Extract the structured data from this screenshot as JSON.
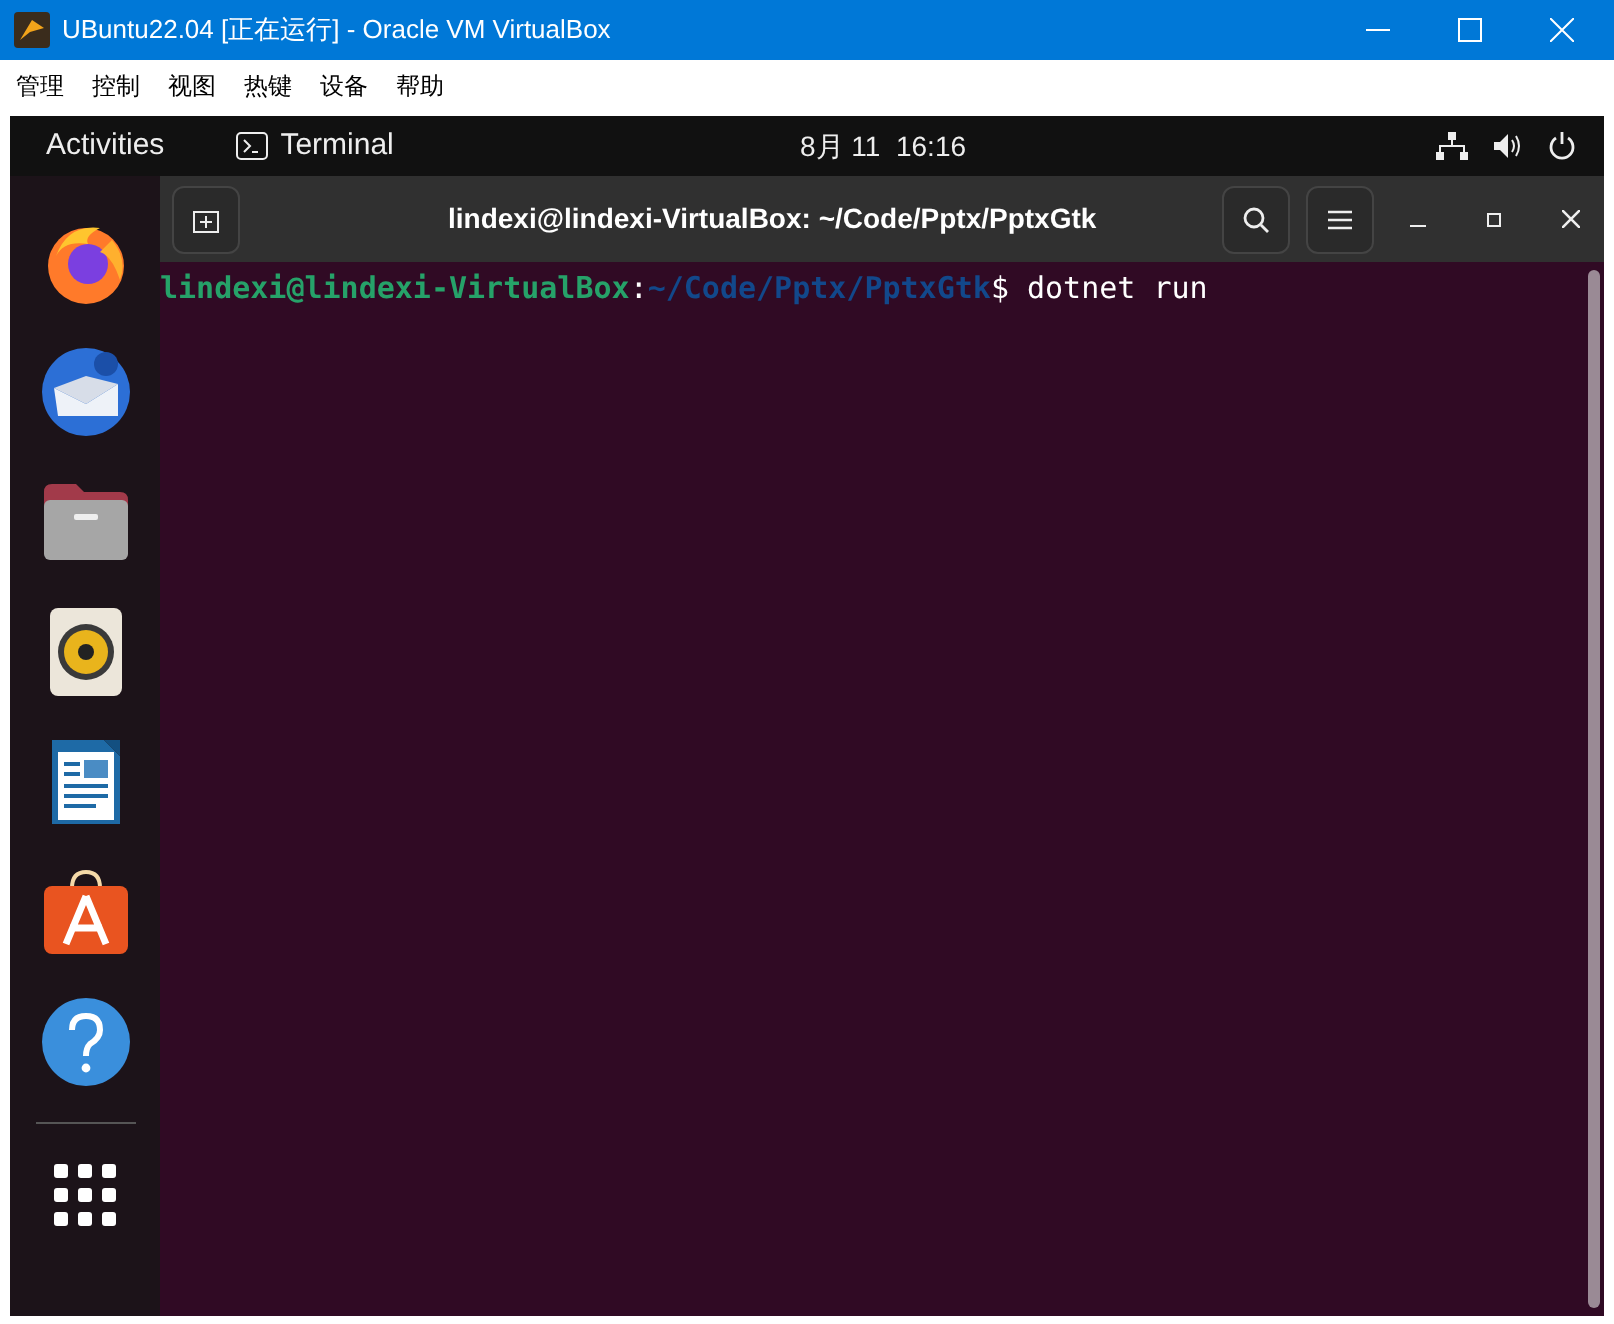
{
  "window": {
    "title": "UBuntu22.04 [正在运行] - Oracle VM VirtualBox"
  },
  "menu": [
    "管理",
    "控制",
    "视图",
    "热键",
    "设备",
    "帮助"
  ],
  "top_bar": {
    "activities": "Activities",
    "app": "Terminal",
    "clock": "8月 11  16:16"
  },
  "dock": [
    {
      "kind": "firefox"
    },
    {
      "kind": "thunderbird"
    },
    {
      "kind": "files"
    },
    {
      "kind": "rhythmbox"
    },
    {
      "kind": "writer"
    },
    {
      "kind": "appstore"
    },
    {
      "kind": "help"
    }
  ],
  "terminal": {
    "title": "lindexi@lindexi-VirtualBox: ~/Code/Pptx/PptxGtk",
    "prompt_user": "lindexi@lindexi-VirtualBox",
    "prompt_sep": ":",
    "prompt_path": "~/Code/Pptx/PptxGtk",
    "prompt_symbol": "$",
    "command": "dotnet run"
  }
}
